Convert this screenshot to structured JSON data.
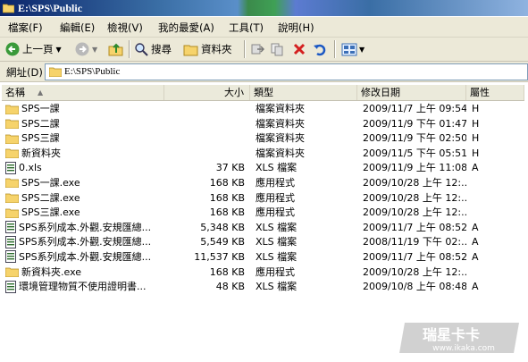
{
  "window": {
    "title": "E:\\SPS\\Public"
  },
  "menu": [
    "檔案(F)",
    "編輯(E)",
    "檢視(V)",
    "我的最愛(A)",
    "工具(T)",
    "說明(H)"
  ],
  "toolbar": {
    "back": "上一頁",
    "search": "搜尋",
    "folders": "資料夾"
  },
  "address": {
    "label": "網址(D)",
    "value": "E:\\SPS\\Public"
  },
  "columns": {
    "name": "名稱",
    "size": "大小",
    "type": "類型",
    "date": "修改日期",
    "attr": "屬性"
  },
  "files": [
    {
      "icon": "folder",
      "name": "SPS一課",
      "size": "",
      "type": "檔案資料夾",
      "date": "2009/11/7 上午 09:54",
      "attr": "H"
    },
    {
      "icon": "folder",
      "name": "SPS二課",
      "size": "",
      "type": "檔案資料夾",
      "date": "2009/11/9 下午 01:47",
      "attr": "H"
    },
    {
      "icon": "folder",
      "name": "SPS三課",
      "size": "",
      "type": "檔案資料夾",
      "date": "2009/11/9 下午 02:50",
      "attr": "H"
    },
    {
      "icon": "folder",
      "name": "新資料夾",
      "size": "",
      "type": "檔案資料夾",
      "date": "2009/11/5 下午 05:51",
      "attr": "H"
    },
    {
      "icon": "xls",
      "name": "0.xls",
      "size": "37 KB",
      "type": "XLS 檔案",
      "date": "2009/11/9 上午 11:08",
      "attr": "A"
    },
    {
      "icon": "folder",
      "name": "SPS一課.exe",
      "size": "168 KB",
      "type": "應用程式",
      "date": "2009/10/28 上午 12:...",
      "attr": ""
    },
    {
      "icon": "folder",
      "name": "SPS二課.exe",
      "size": "168 KB",
      "type": "應用程式",
      "date": "2009/10/28 上午 12:...",
      "attr": ""
    },
    {
      "icon": "folder",
      "name": "SPS三課.exe",
      "size": "168 KB",
      "type": "應用程式",
      "date": "2009/10/28 上午 12:...",
      "attr": ""
    },
    {
      "icon": "xls",
      "name": "SPS系列成本.外觀.安規匯總...",
      "size": "5,348 KB",
      "type": "XLS 檔案",
      "date": "2009/11/7 上午 08:52",
      "attr": "A"
    },
    {
      "icon": "xls",
      "name": "SPS系列成本.外觀.安規匯總...",
      "size": "5,549 KB",
      "type": "XLS 檔案",
      "date": "2008/11/19 下午 02:...",
      "attr": "A"
    },
    {
      "icon": "xls",
      "name": "SPS系列成本.外觀.安規匯總...",
      "size": "11,537 KB",
      "type": "XLS 檔案",
      "date": "2009/11/7 上午 08:52",
      "attr": "A"
    },
    {
      "icon": "folder",
      "name": "新資料夾.exe",
      "size": "168 KB",
      "type": "應用程式",
      "date": "2009/10/28 上午 12:...",
      "attr": ""
    },
    {
      "icon": "xls",
      "name": "環境管理物質不使用證明書...",
      "size": "48 KB",
      "type": "XLS 檔案",
      "date": "2009/10/8 上午 08:48",
      "attr": "A"
    }
  ],
  "watermark": {
    "logo": "瑞星卡卡",
    "url": "www.ikaka.com"
  }
}
